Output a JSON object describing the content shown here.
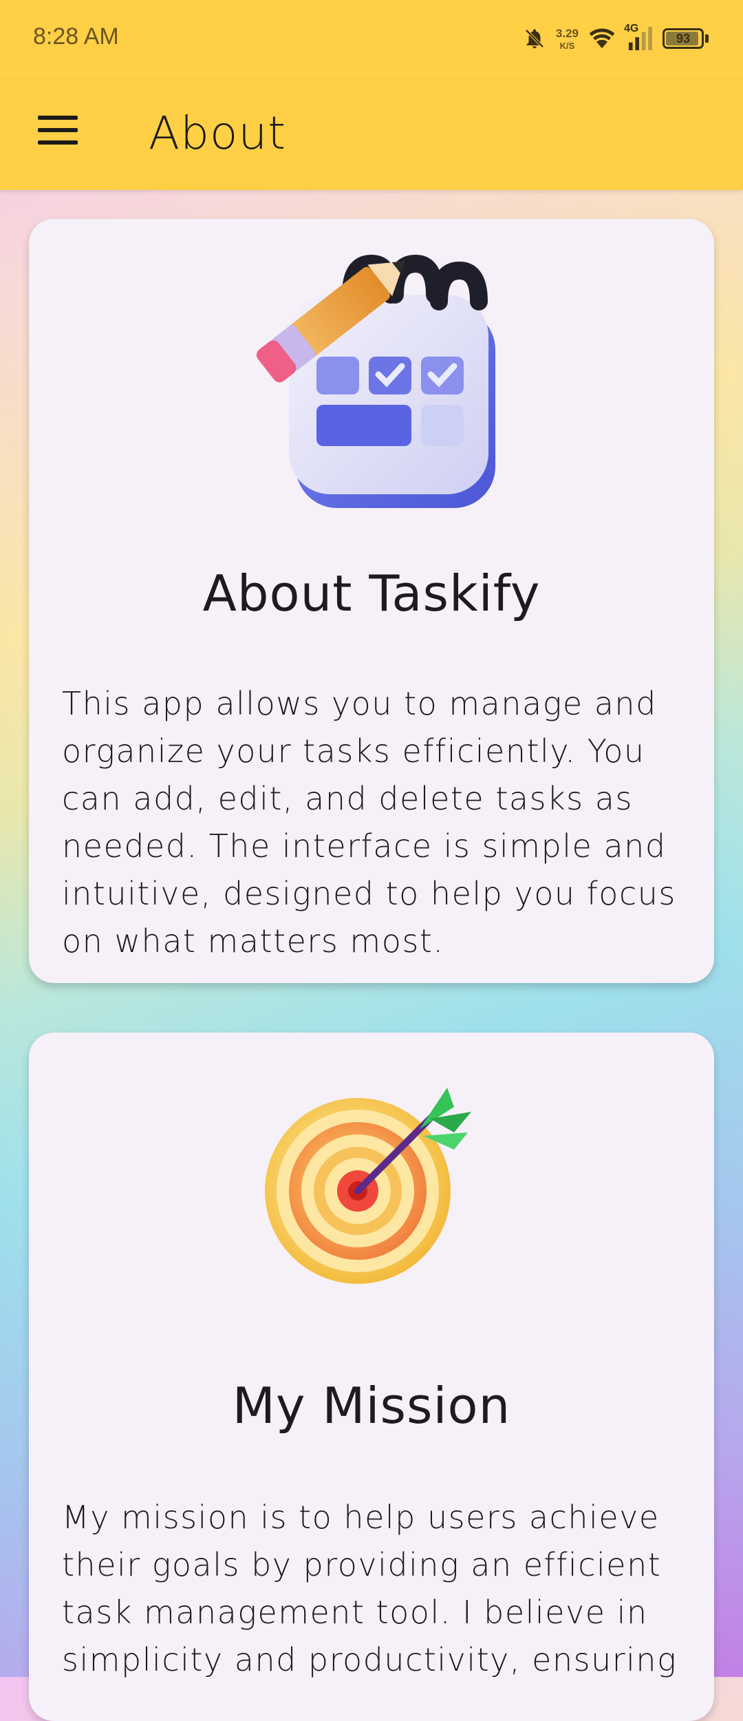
{
  "status_bar": {
    "time": "8:28 AM",
    "net_speed_value": "3.29",
    "net_speed_unit": "K/S",
    "network_type": "4G",
    "battery_level": "93",
    "icons": [
      "bell-muted-icon",
      "wifi-icon",
      "signal-icon",
      "battery-icon"
    ]
  },
  "app_bar": {
    "title": "About",
    "menu_icon": "hamburger-menu-icon",
    "background": "#ffcf45"
  },
  "cards": [
    {
      "illustration": "calendar-checklist-pencil-icon",
      "heading": "About Taskify",
      "body": "This app allows you to manage and organize your tasks efficiently. You can add, edit, and delete tasks as needed. The interface is simple and intuitive, designed to help you focus on what matters most."
    },
    {
      "illustration": "target-dart-icon",
      "heading": "My Mission",
      "body": "My mission is to help users achieve their goals by providing an efficient task management tool. I believe in simplicity and productivity, ensuring"
    }
  ],
  "colors": {
    "accent": "#ffcf45",
    "card_background": "#f6f1f9",
    "text": "#1d1b20"
  }
}
